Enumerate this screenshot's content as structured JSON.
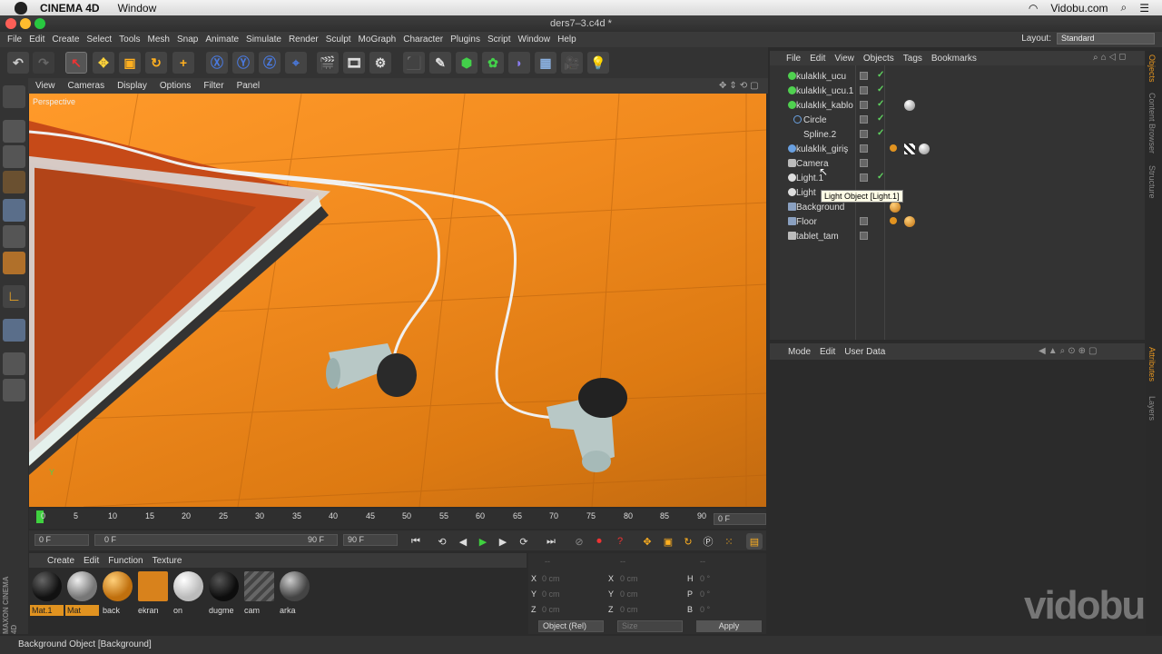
{
  "macbar": {
    "app": "CINEMA 4D",
    "menu": "Window",
    "site": "Vidobu.com"
  },
  "window": {
    "title": "ders7–3.c4d *"
  },
  "menu": [
    "File",
    "Edit",
    "Create",
    "Select",
    "Tools",
    "Mesh",
    "Snap",
    "Animate",
    "Simulate",
    "Render",
    "Sculpt",
    "MoGraph",
    "Character",
    "Plugins",
    "Script",
    "Window",
    "Help"
  ],
  "layout": {
    "label": "Layout:",
    "value": "Standard"
  },
  "viewport": {
    "menus": [
      "View",
      "Cameras",
      "Display",
      "Options",
      "Filter",
      "Panel"
    ],
    "label": "Perspective"
  },
  "timeline": {
    "ticks": [
      "0",
      "5",
      "10",
      "15",
      "20",
      "25",
      "30",
      "35",
      "40",
      "45",
      "50",
      "55",
      "60",
      "65",
      "70",
      "75",
      "80",
      "85",
      "90"
    ],
    "current": "0 F"
  },
  "transport": {
    "start": "0 F",
    "range_start": "0 F",
    "range_end": "90 F",
    "end": "90 F"
  },
  "materials": {
    "menus": [
      "Create",
      "Edit",
      "Function",
      "Texture"
    ],
    "items": [
      {
        "name": "Mat.1",
        "color": "#111111",
        "selected": true
      },
      {
        "name": "Mat",
        "color": "#9a9a9a",
        "selected": true
      },
      {
        "name": "back",
        "color": "#e19320",
        "selected": false
      },
      {
        "name": "ekran",
        "color": "#d8821c",
        "selected": false
      },
      {
        "name": "on",
        "color": "#e8e8e8",
        "selected": false
      },
      {
        "name": "dugme",
        "color": "#1a1a1a",
        "selected": false
      },
      {
        "name": "cam",
        "color": "#555555",
        "selected": false
      },
      {
        "name": "arka",
        "color": "#777777",
        "selected": false
      }
    ]
  },
  "coords": {
    "header": [
      "--",
      "--",
      "--"
    ],
    "rows": [
      {
        "a": "X",
        "av": "0 cm",
        "b": "X",
        "bv": "0 cm",
        "c": "H",
        "cv": "0 °"
      },
      {
        "a": "Y",
        "av": "0 cm",
        "b": "Y",
        "bv": "0 cm",
        "c": "P",
        "cv": "0 °"
      },
      {
        "a": "Z",
        "av": "0 cm",
        "b": "Z",
        "bv": "0 cm",
        "c": "B",
        "cv": "0 °"
      }
    ],
    "mode": "Object (Rel)",
    "size": "Size",
    "apply": "Apply"
  },
  "objects": {
    "menus": [
      "File",
      "Edit",
      "View",
      "Objects",
      "Tags",
      "Bookmarks"
    ],
    "items": [
      {
        "name": "kulaklık_ucu",
        "icon": "#4fd04f"
      },
      {
        "name": "kulaklık_ucu.1",
        "icon": "#4fd04f"
      },
      {
        "name": "kulaklık_kablo",
        "icon": "#4fd04f"
      },
      {
        "name": "Circle",
        "icon": "#6aa0e0"
      },
      {
        "name": "Spline.2",
        "icon": "#6aa0e0"
      },
      {
        "name": "kulaklık_giriş",
        "icon": "#6aa0e0"
      },
      {
        "name": "Camera",
        "icon": "#bbbbbb"
      },
      {
        "name": "Light.1",
        "icon": "#dddddd"
      },
      {
        "name": "Light",
        "icon": "#dddddd"
      },
      {
        "name": "Background",
        "icon": "#8aa0c0"
      },
      {
        "name": "Floor",
        "icon": "#8aa0c0"
      },
      {
        "name": "tablet_tam",
        "icon": "#bbbbbb"
      }
    ]
  },
  "tooltip": "Light Object [Light.1]",
  "attributes": {
    "menus": [
      "Mode",
      "Edit",
      "User Data"
    ]
  },
  "sidetabs": [
    "Objects",
    "Content Browser",
    "Structure",
    "Attributes",
    "Layers"
  ],
  "status": "Background Object [Background]",
  "watermark": "vidobu",
  "brand": "MAXON CINEMA 4D"
}
